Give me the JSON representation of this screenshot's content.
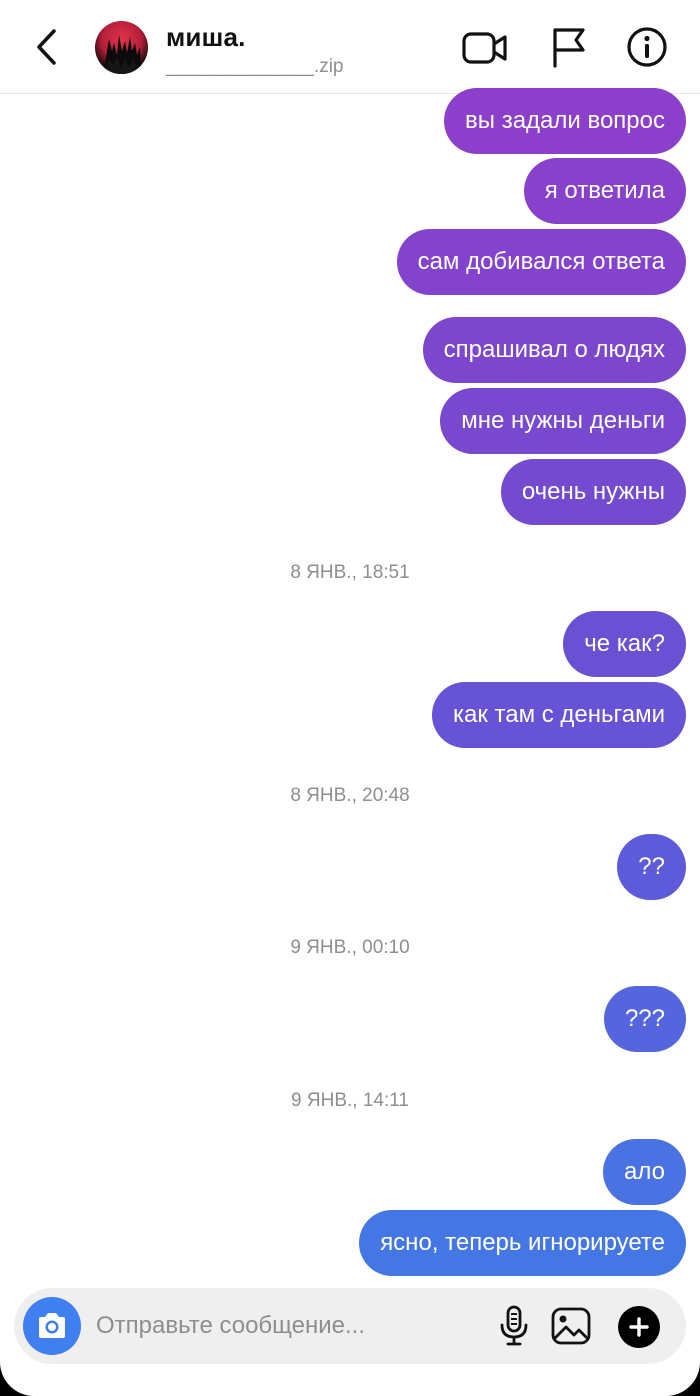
{
  "header": {
    "title": "миша.",
    "subtitle": "______________.zip"
  },
  "messages": [
    {
      "text": "вы задали вопрос",
      "color": "#8b3fcb"
    },
    {
      "text": "я ответила",
      "color": "#8741cb"
    },
    {
      "text": "сам добивался ответа",
      "color": "#8443cc"
    },
    {
      "text": "спрашивал о людях",
      "color": "#7c47cd"
    },
    {
      "text": "мне нужны деньги",
      "color": "#7849ce"
    },
    {
      "text": "очень нужны",
      "color": "#744bcf"
    },
    {
      "text": "че как?",
      "color": "#6a51d4"
    },
    {
      "text": "как там с деньгами",
      "color": "#6653d5"
    },
    {
      "text": "??",
      "color": "#5e5bda"
    },
    {
      "text": "???",
      "color": "#5565de"
    },
    {
      "text": "ало",
      "color": "#4b72e2"
    },
    {
      "text": "ясно, теперь игнорируете",
      "color": "#4577e4"
    }
  ],
  "timestamps": [
    "8 ЯНВ., 18:51",
    "8 ЯНВ., 20:48",
    "9 ЯНВ., 00:10",
    "9 ЯНВ., 14:11"
  ],
  "composer": {
    "placeholder": "Отправьте сообщение..."
  },
  "icons": {
    "back": "chevron-left",
    "video": "video-camera",
    "flag": "flag",
    "info": "info-circle",
    "camera": "camera",
    "mic": "microphone",
    "gallery": "image",
    "plus": "plus-circle"
  }
}
